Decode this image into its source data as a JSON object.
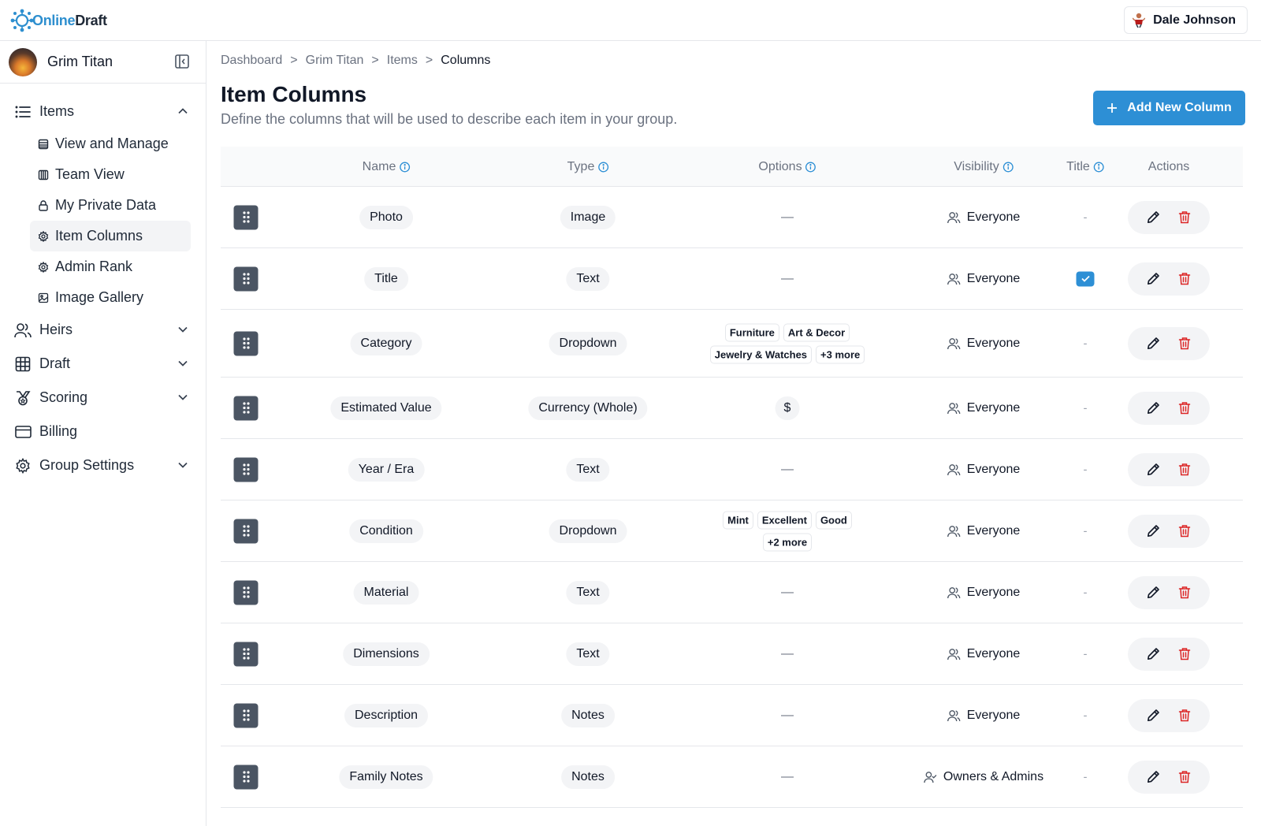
{
  "app": {
    "logo_part1": "Online",
    "logo_part2": "Draft",
    "user_name": "Dale Johnson"
  },
  "sidebar": {
    "group_name": "Grim Titan",
    "items_section": {
      "label": "Items",
      "icon": "list-icon",
      "subitems": [
        {
          "label": "View and Manage",
          "icon": "table-icon"
        },
        {
          "label": "Team View",
          "icon": "columns-icon"
        },
        {
          "label": "My Private Data",
          "icon": "lock-icon"
        },
        {
          "label": "Item Columns",
          "icon": "gear-icon",
          "active": true
        },
        {
          "label": "Admin Rank",
          "icon": "gear-icon"
        },
        {
          "label": "Image Gallery",
          "icon": "image-icon"
        }
      ]
    },
    "nav": [
      {
        "label": "Heirs",
        "icon": "users-icon"
      },
      {
        "label": "Draft",
        "icon": "grid-icon"
      },
      {
        "label": "Scoring",
        "icon": "medal-icon"
      },
      {
        "label": "Billing",
        "icon": "credit-card-icon"
      },
      {
        "label": "Group Settings",
        "icon": "gear-icon"
      }
    ]
  },
  "breadcrumb": {
    "items": [
      "Dashboard",
      "Grim Titan",
      "Items",
      "Columns"
    ],
    "separator": ">"
  },
  "page": {
    "title": "Item Columns",
    "subtitle": "Define the columns that will be used to describe each item in your group.",
    "add_button": "Add New Column"
  },
  "table": {
    "headers": {
      "name": "Name",
      "type": "Type",
      "options": "Options",
      "visibility": "Visibility",
      "title": "Title",
      "actions": "Actions"
    },
    "empty_options": "—",
    "no_title": "-",
    "rows": [
      {
        "name": "Photo",
        "type": "Image",
        "options": [],
        "visibility": "Everyone",
        "is_title": false
      },
      {
        "name": "Title",
        "type": "Text",
        "options": [],
        "visibility": "Everyone",
        "is_title": true
      },
      {
        "name": "Category",
        "type": "Dropdown",
        "options": [
          "Furniture",
          "Art & Decor",
          "Jewelry & Watches",
          "+3 more"
        ],
        "visibility": "Everyone",
        "is_title": false
      },
      {
        "name": "Estimated Value",
        "type": "Currency (Whole)",
        "options": [
          "$"
        ],
        "options_style": "pill",
        "visibility": "Everyone",
        "is_title": false
      },
      {
        "name": "Year / Era",
        "type": "Text",
        "options": [],
        "visibility": "Everyone",
        "is_title": false
      },
      {
        "name": "Condition",
        "type": "Dropdown",
        "options": [
          "Mint",
          "Excellent",
          "Good",
          "+2 more"
        ],
        "visibility": "Everyone",
        "is_title": false
      },
      {
        "name": "Material",
        "type": "Text",
        "options": [],
        "visibility": "Everyone",
        "is_title": false
      },
      {
        "name": "Dimensions",
        "type": "Text",
        "options": [],
        "visibility": "Everyone",
        "is_title": false
      },
      {
        "name": "Description",
        "type": "Notes",
        "options": [],
        "visibility": "Everyone",
        "is_title": false
      },
      {
        "name": "Family Notes",
        "type": "Notes",
        "options": [],
        "visibility": "Owners & Admins",
        "visibility_icon": "user-check-icon",
        "is_title": false
      }
    ]
  },
  "colors": {
    "accent": "#2d8fd5",
    "delete": "#dc2626",
    "handle": "#4b5563"
  }
}
